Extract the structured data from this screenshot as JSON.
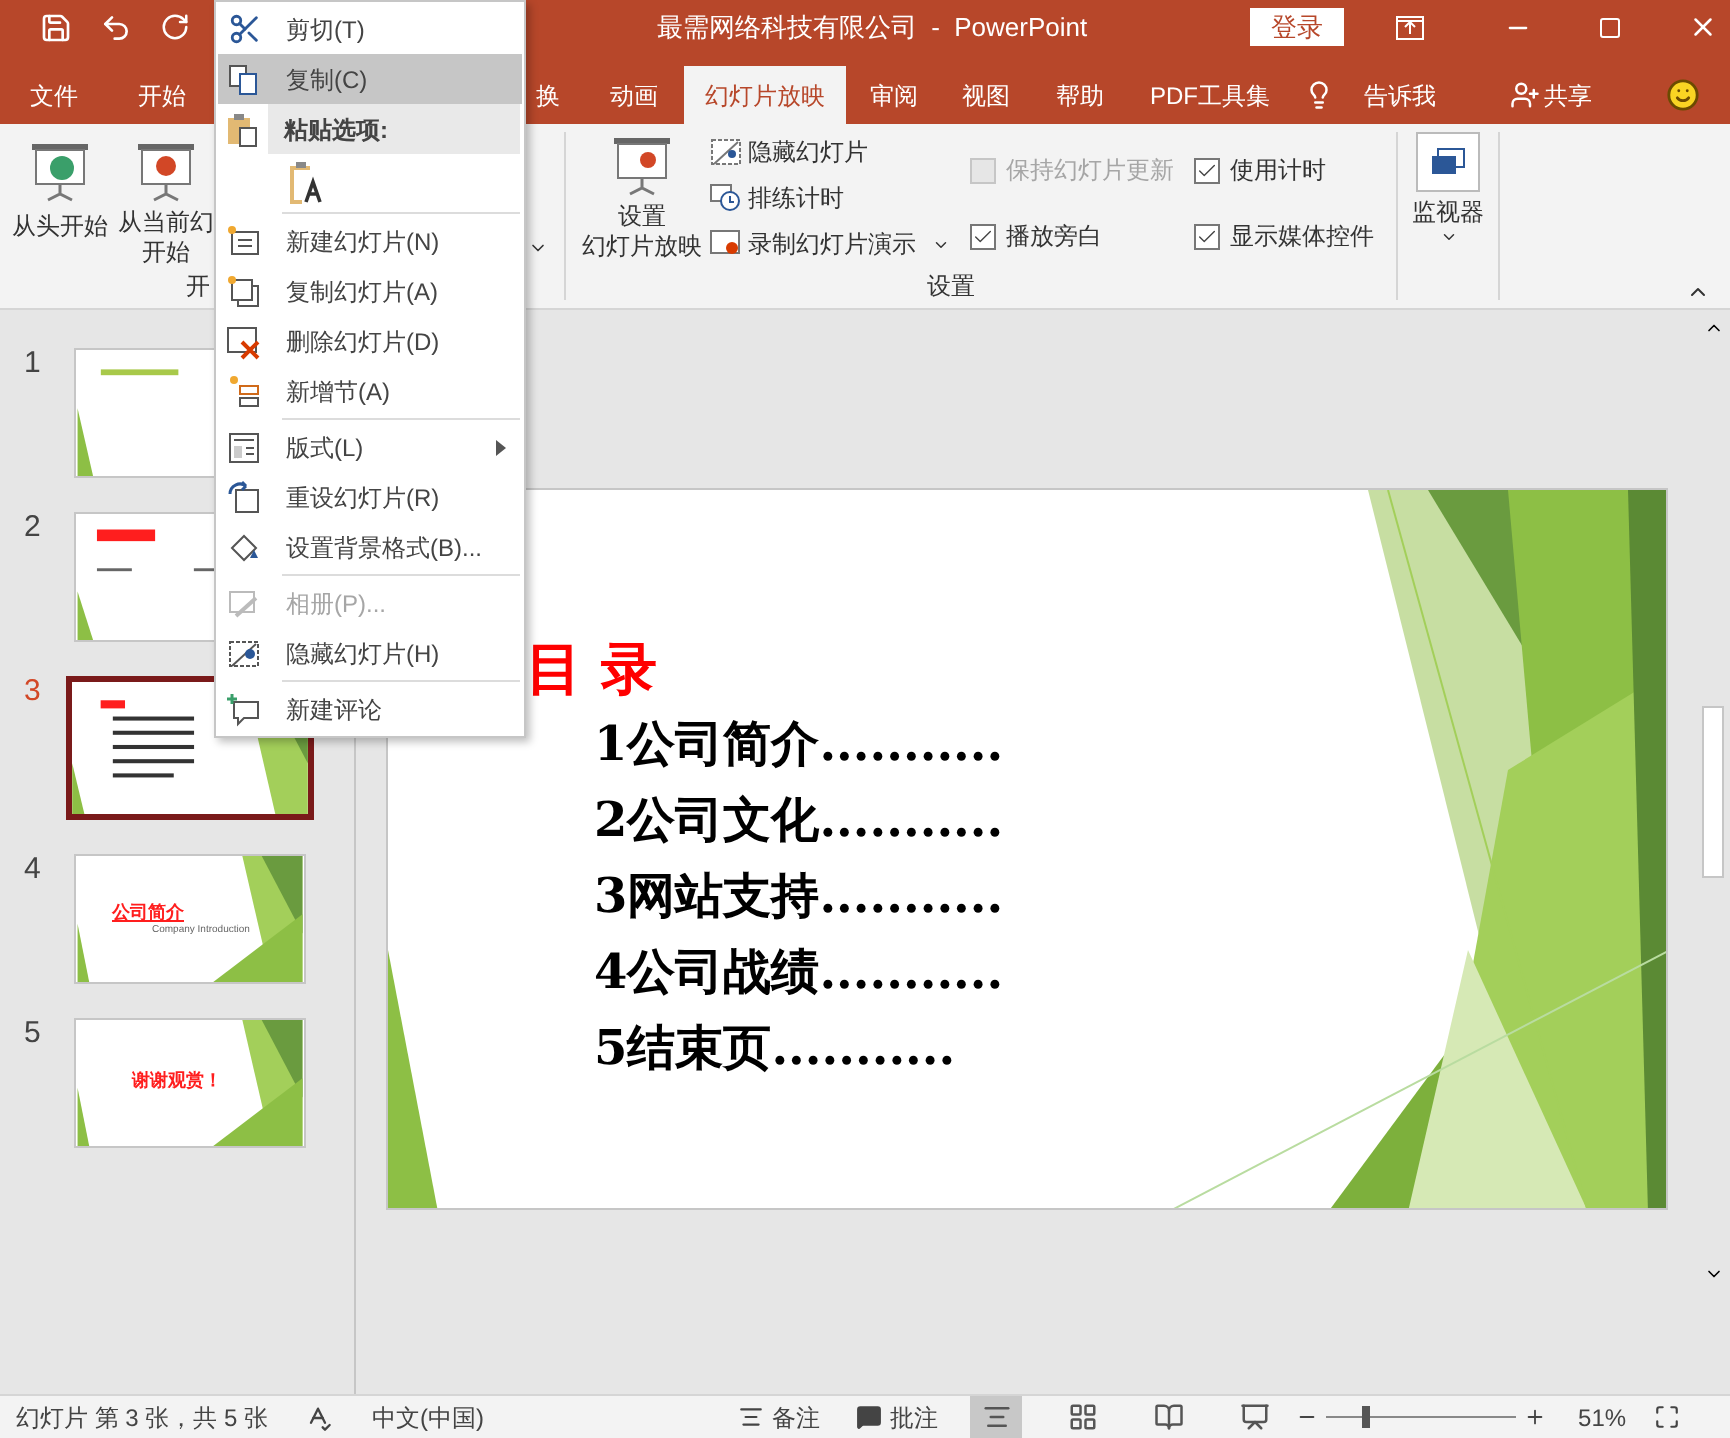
{
  "title_bar": {
    "title": "最需网络科技有限公司  -  PowerPoint",
    "sign_in": "登录"
  },
  "tabs": [
    {
      "label": "文件",
      "selected": false
    },
    {
      "label": "开始",
      "selected": false
    },
    {
      "label": "换",
      "selected": false
    },
    {
      "label": "动画",
      "selected": false
    },
    {
      "label": "幻灯片放映",
      "selected": true
    },
    {
      "label": "审阅",
      "selected": false
    },
    {
      "label": "视图",
      "selected": false
    },
    {
      "label": "帮助",
      "selected": false
    },
    {
      "label": "PDF工具集",
      "selected": false
    }
  ],
  "tell_me": "告诉我",
  "share": "共享",
  "ribbon": {
    "start_group": {
      "from_beginning": "从头开始",
      "from_current": [
        "从当前幻",
        "开始"
      ],
      "group_label": "开"
    },
    "setup_group": {
      "setup_button": [
        "设置",
        "幻灯片放映"
      ],
      "commands": [
        {
          "label": "隐藏幻灯片",
          "dropdown": false
        },
        {
          "label": "排练计时",
          "dropdown": false
        },
        {
          "label": "录制幻灯片演示",
          "dropdown": true
        }
      ],
      "checkboxes": [
        {
          "label": "保持幻灯片更新",
          "checked": false,
          "disabled": true
        },
        {
          "label": "使用计时",
          "checked": true,
          "disabled": false
        },
        {
          "label": "播放旁白",
          "checked": true,
          "disabled": false
        },
        {
          "label": "显示媒体控件",
          "checked": true,
          "disabled": false
        }
      ],
      "group_label": "设置"
    },
    "monitor": {
      "label": "监视器"
    }
  },
  "thumbnails": [
    {
      "number": "1",
      "selected": false,
      "kind": "cover"
    },
    {
      "number": "2",
      "selected": false,
      "kind": "heading"
    },
    {
      "number": "3",
      "selected": true,
      "kind": "contents"
    },
    {
      "number": "4",
      "selected": false,
      "kind": "section",
      "title": "公司简介",
      "subtitle": "Company Introduction"
    },
    {
      "number": "5",
      "selected": false,
      "kind": "closing",
      "title": "谢谢观赏！"
    }
  ],
  "slide": {
    "title": "目 录",
    "items": [
      "1公司简介...........",
      "2公司文化...........",
      "3网站支持...........",
      "4公司战绩...........",
      "5结束页..........."
    ]
  },
  "context_menu": [
    {
      "kind": "item",
      "label": "剪切(T)",
      "selected": false,
      "disabled": false,
      "submenu": false
    },
    {
      "kind": "item",
      "label": "复制(C)",
      "selected": true,
      "disabled": false,
      "submenu": false
    },
    {
      "kind": "header",
      "label": "粘贴选项:"
    },
    {
      "kind": "paste"
    },
    {
      "kind": "separator"
    },
    {
      "kind": "item",
      "label": "新建幻灯片(N)",
      "selected": false,
      "disabled": false,
      "submenu": false
    },
    {
      "kind": "item",
      "label": "复制幻灯片(A)",
      "selected": false,
      "disabled": false,
      "submenu": false
    },
    {
      "kind": "item",
      "label": "删除幻灯片(D)",
      "selected": false,
      "disabled": false,
      "submenu": false
    },
    {
      "kind": "item",
      "label": "新增节(A)",
      "selected": false,
      "disabled": false,
      "submenu": false
    },
    {
      "kind": "separator"
    },
    {
      "kind": "item",
      "label": "版式(L)",
      "selected": false,
      "disabled": false,
      "submenu": true
    },
    {
      "kind": "item",
      "label": "重设幻灯片(R)",
      "selected": false,
      "disabled": false,
      "submenu": false
    },
    {
      "kind": "item",
      "label": "设置背景格式(B)...",
      "selected": false,
      "disabled": false,
      "submenu": false
    },
    {
      "kind": "separator"
    },
    {
      "kind": "item",
      "label": "相册(P)...",
      "selected": false,
      "disabled": true,
      "submenu": false
    },
    {
      "kind": "item",
      "label": "隐藏幻灯片(H)",
      "selected": false,
      "disabled": false,
      "submenu": false
    },
    {
      "kind": "separator"
    },
    {
      "kind": "item",
      "label": "新建评论",
      "selected": false,
      "disabled": false,
      "submenu": false
    }
  ],
  "status_bar": {
    "slide_info": "幻灯片 第 3 张，共 5 张",
    "language": "中文(中国)",
    "notes": "备注",
    "comments": "批注",
    "views": [
      {
        "kind": "normal",
        "selected": true
      },
      {
        "kind": "sorter",
        "selected": false
      },
      {
        "kind": "reading",
        "selected": false
      },
      {
        "kind": "slideshow",
        "selected": false
      }
    ],
    "zoom": {
      "level": 0.21,
      "reading": "51%"
    }
  }
}
